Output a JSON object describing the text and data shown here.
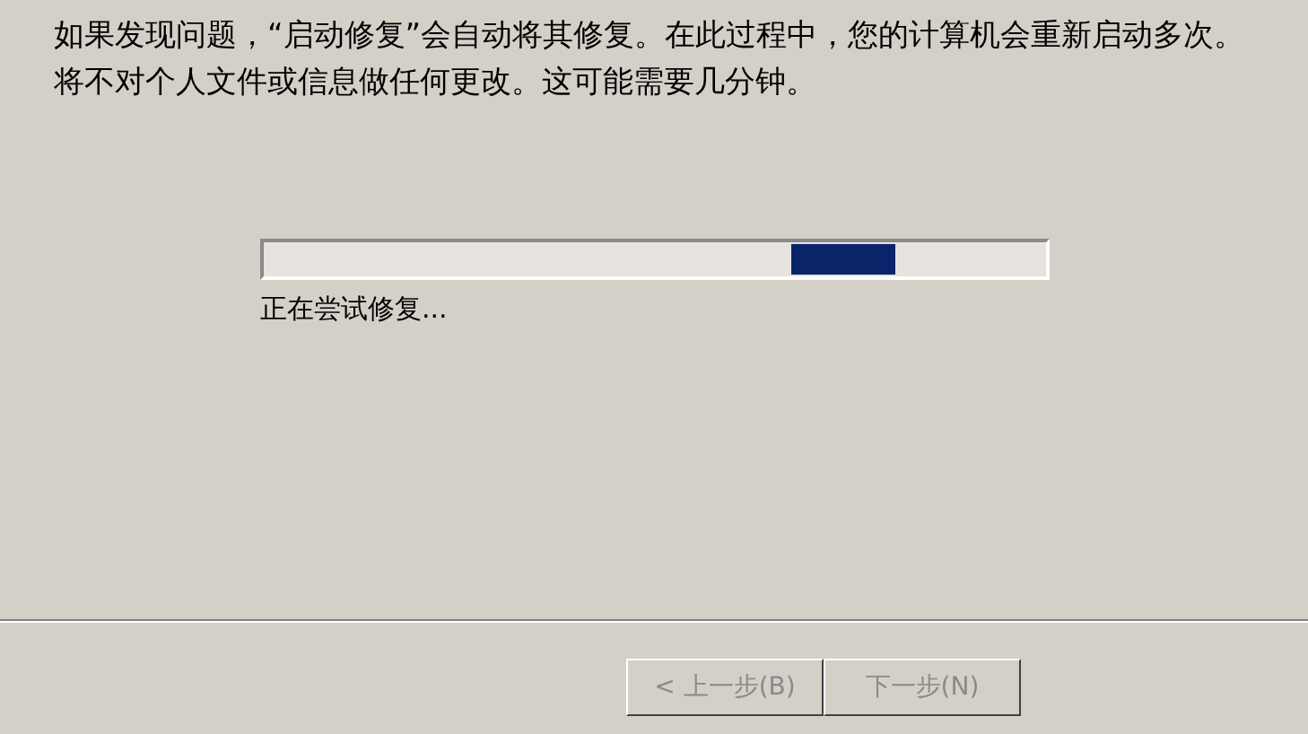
{
  "message": "如果发现问题，“启动修复”会自动将其修复。在此过程中，您的计算机会重新启动多次。",
  "note": "将不对个人文件或信息做任何更改。这可能需要几分钟。",
  "progress": {
    "kind": "marquee",
    "status": "正在尝试修复..."
  },
  "buttons": [
    {
      "label": "< 上一步(B)",
      "disabled": true
    },
    {
      "label": "下一步(N)",
      "disabled": true
    }
  ]
}
